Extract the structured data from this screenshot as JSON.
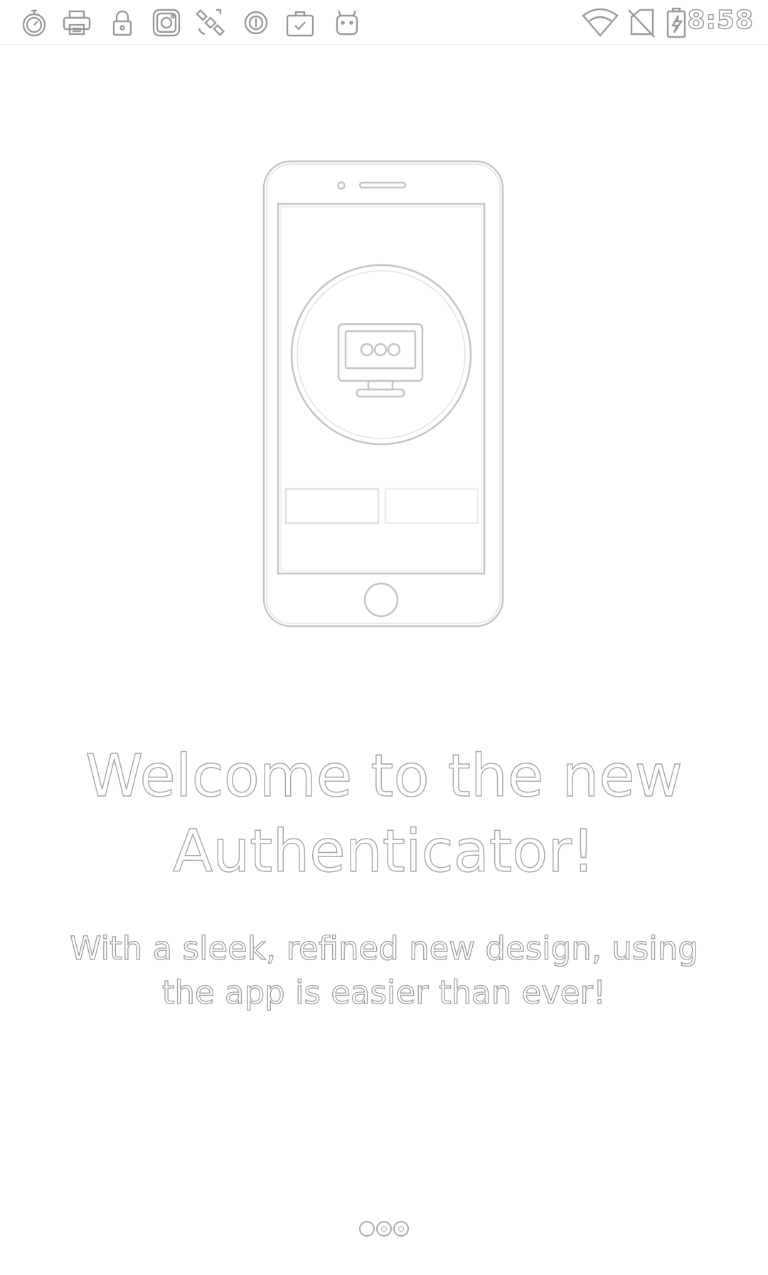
{
  "status_bar": {
    "left_icons": [
      "stopwatch-icon",
      "printer-icon",
      "lock-icon",
      "instagram-icon",
      "satellite-icon",
      "circle-app-icon",
      "briefcase-check-icon",
      "android-icon"
    ],
    "right_icons": [
      "wifi-icon",
      "no-sim-icon",
      "battery-charging-icon"
    ],
    "time": "8:58"
  },
  "onboarding": {
    "illustration_icon": "phone-desktop-illustration-icon",
    "title_line1": "Welcome to the new",
    "title_line2": "Authenticator!",
    "subtitle_line1": "With a sleek, refined new design, using",
    "subtitle_line2": "the app is easier than ever!",
    "page_count": 3,
    "current_page": 1
  },
  "colors": {
    "background": "#ffffff",
    "outline": "#a6a6a6"
  }
}
